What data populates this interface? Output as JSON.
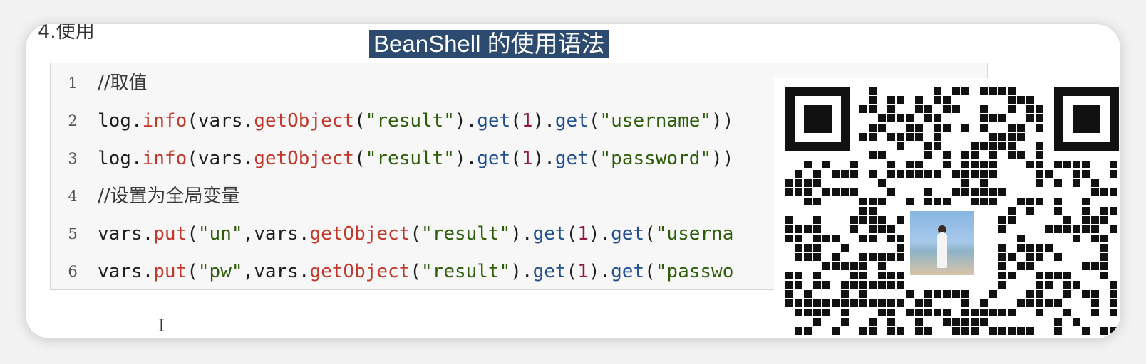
{
  "heading": "4.使用",
  "subtitle": "BeanShell 的使用语法",
  "code": {
    "lines": [
      {
        "num": "1",
        "comment": "//取值"
      },
      {
        "num": "2",
        "tokens": [
          {
            "t": "log",
            "c": "plain"
          },
          {
            "t": ".",
            "c": "plain"
          },
          {
            "t": "info",
            "c": "fn"
          },
          {
            "t": "(",
            "c": "plain"
          },
          {
            "t": "vars",
            "c": "plain"
          },
          {
            "t": ".",
            "c": "plain"
          },
          {
            "t": "getObject",
            "c": "fn"
          },
          {
            "t": "(",
            "c": "plain"
          },
          {
            "t": "\"result\"",
            "c": "str"
          },
          {
            "t": ")",
            "c": "plain"
          },
          {
            "t": ".",
            "c": "plain"
          },
          {
            "t": "get",
            "c": "mth"
          },
          {
            "t": "(",
            "c": "plain"
          },
          {
            "t": "1",
            "c": "num"
          },
          {
            "t": ")",
            "c": "plain"
          },
          {
            "t": ".",
            "c": "plain"
          },
          {
            "t": "get",
            "c": "mth"
          },
          {
            "t": "(",
            "c": "plain"
          },
          {
            "t": "\"username\"",
            "c": "str"
          },
          {
            "t": "))",
            "c": "plain"
          }
        ]
      },
      {
        "num": "3",
        "tokens": [
          {
            "t": "log",
            "c": "plain"
          },
          {
            "t": ".",
            "c": "plain"
          },
          {
            "t": "info",
            "c": "fn"
          },
          {
            "t": "(",
            "c": "plain"
          },
          {
            "t": "vars",
            "c": "plain"
          },
          {
            "t": ".",
            "c": "plain"
          },
          {
            "t": "getObject",
            "c": "fn"
          },
          {
            "t": "(",
            "c": "plain"
          },
          {
            "t": "\"result\"",
            "c": "str"
          },
          {
            "t": ")",
            "c": "plain"
          },
          {
            "t": ".",
            "c": "plain"
          },
          {
            "t": "get",
            "c": "mth"
          },
          {
            "t": "(",
            "c": "plain"
          },
          {
            "t": "1",
            "c": "num"
          },
          {
            "t": ")",
            "c": "plain"
          },
          {
            "t": ".",
            "c": "plain"
          },
          {
            "t": "get",
            "c": "mth"
          },
          {
            "t": "(",
            "c": "plain"
          },
          {
            "t": "\"password\"",
            "c": "str"
          },
          {
            "t": "))",
            "c": "plain"
          }
        ]
      },
      {
        "num": "4",
        "comment": "//设置为全局变量"
      },
      {
        "num": "5",
        "tokens": [
          {
            "t": "vars",
            "c": "plain"
          },
          {
            "t": ".",
            "c": "plain"
          },
          {
            "t": "put",
            "c": "fn"
          },
          {
            "t": "(",
            "c": "plain"
          },
          {
            "t": "\"un\"",
            "c": "str"
          },
          {
            "t": ",",
            "c": "plain"
          },
          {
            "t": "vars",
            "c": "plain"
          },
          {
            "t": ".",
            "c": "plain"
          },
          {
            "t": "getObject",
            "c": "fn"
          },
          {
            "t": "(",
            "c": "plain"
          },
          {
            "t": "\"result\"",
            "c": "str"
          },
          {
            "t": ")",
            "c": "plain"
          },
          {
            "t": ".",
            "c": "plain"
          },
          {
            "t": "get",
            "c": "mth"
          },
          {
            "t": "(",
            "c": "plain"
          },
          {
            "t": "1",
            "c": "num"
          },
          {
            "t": ")",
            "c": "plain"
          },
          {
            "t": ".",
            "c": "plain"
          },
          {
            "t": "get",
            "c": "mth"
          },
          {
            "t": "(",
            "c": "plain"
          },
          {
            "t": "\"userna",
            "c": "str"
          }
        ]
      },
      {
        "num": "6",
        "tokens": [
          {
            "t": "vars",
            "c": "plain"
          },
          {
            "t": ".",
            "c": "plain"
          },
          {
            "t": "put",
            "c": "fn"
          },
          {
            "t": "(",
            "c": "plain"
          },
          {
            "t": "\"pw\"",
            "c": "str"
          },
          {
            "t": ",",
            "c": "plain"
          },
          {
            "t": "vars",
            "c": "plain"
          },
          {
            "t": ".",
            "c": "plain"
          },
          {
            "t": "getObject",
            "c": "fn"
          },
          {
            "t": "(",
            "c": "plain"
          },
          {
            "t": "\"result\"",
            "c": "str"
          },
          {
            "t": ")",
            "c": "plain"
          },
          {
            "t": ".",
            "c": "plain"
          },
          {
            "t": "get",
            "c": "mth"
          },
          {
            "t": "(",
            "c": "plain"
          },
          {
            "t": "1",
            "c": "num"
          },
          {
            "t": ")",
            "c": "plain"
          },
          {
            "t": ".",
            "c": "plain"
          },
          {
            "t": "get",
            "c": "mth"
          },
          {
            "t": "(",
            "c": "plain"
          },
          {
            "t": "\"passwo",
            "c": "str"
          }
        ]
      }
    ]
  },
  "cursor_glyph": "I",
  "colors": {
    "subtitle_bg": "#2d4b6e",
    "function": "#c0392b",
    "method": "#22508f",
    "string": "#2e5d0a",
    "number": "#8e1b3f"
  },
  "qr_code": {
    "icon": "qr-code-icon",
    "center_image": "photo-thumbnail"
  }
}
